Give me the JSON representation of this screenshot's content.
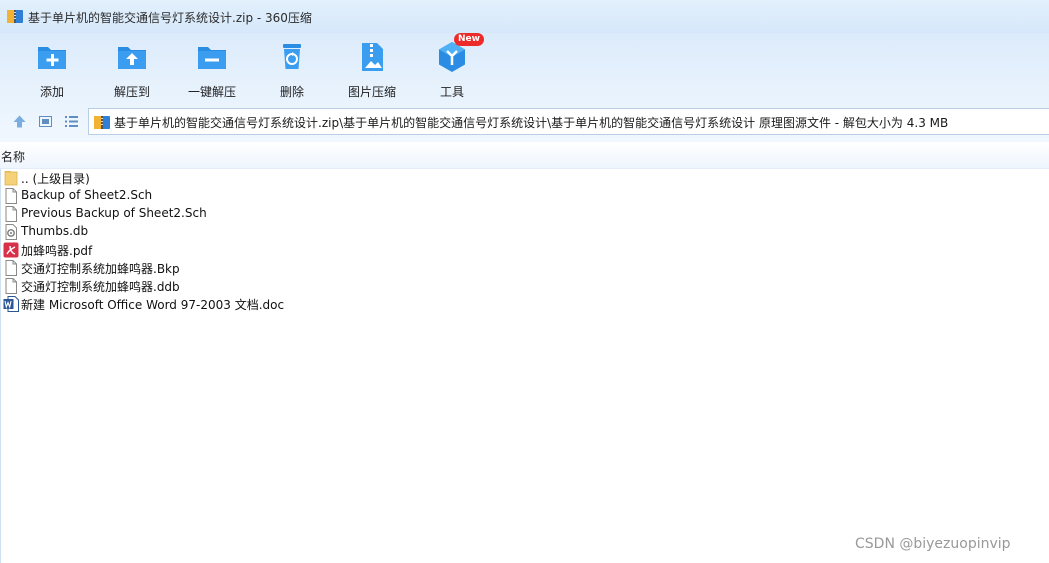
{
  "window": {
    "title": "基于单片机的智能交通信号灯系统设计.zip - 360压缩"
  },
  "toolbar": {
    "buttons": [
      {
        "label": "添加",
        "icon": "add-folder-icon"
      },
      {
        "label": "解压到",
        "icon": "extract-to-icon"
      },
      {
        "label": "一键解压",
        "icon": "one-click-extract-icon"
      },
      {
        "label": "删除",
        "icon": "recycle-bin-icon"
      },
      {
        "label": "图片压缩",
        "icon": "image-compress-icon"
      },
      {
        "label": "工具",
        "icon": "tools-cube-icon",
        "badge": "New"
      }
    ]
  },
  "address": {
    "path": "基于单片机的智能交通信号灯系统设计.zip\\基于单片机的智能交通信号灯系统设计\\基于单片机的智能交通信号灯系统设计 原理图源文件 - 解包大小为 4.3 MB"
  },
  "columns": {
    "name": "名称"
  },
  "files": [
    {
      "name": ".. (上级目录)",
      "icon": "folder-icon"
    },
    {
      "name": "Backup of Sheet2.Sch",
      "icon": "file-icon"
    },
    {
      "name": "Previous Backup of Sheet2.Sch",
      "icon": "file-icon"
    },
    {
      "name": "Thumbs.db",
      "icon": "settings-file-icon"
    },
    {
      "name": "加蜂鸣器.pdf",
      "icon": "pdf-icon"
    },
    {
      "name": "交通灯控制系统加蜂鸣器.Bkp",
      "icon": "file-icon"
    },
    {
      "name": "交通灯控制系统加蜂鸣器.ddb",
      "icon": "file-icon"
    },
    {
      "name": "新建 Microsoft Office Word 97-2003 文档.doc",
      "icon": "word-doc-icon"
    }
  ],
  "watermark": "CSDN @biyezuopinvip",
  "colors": {
    "accent": "#1e8fe1",
    "badge": "#ee2b2b"
  }
}
